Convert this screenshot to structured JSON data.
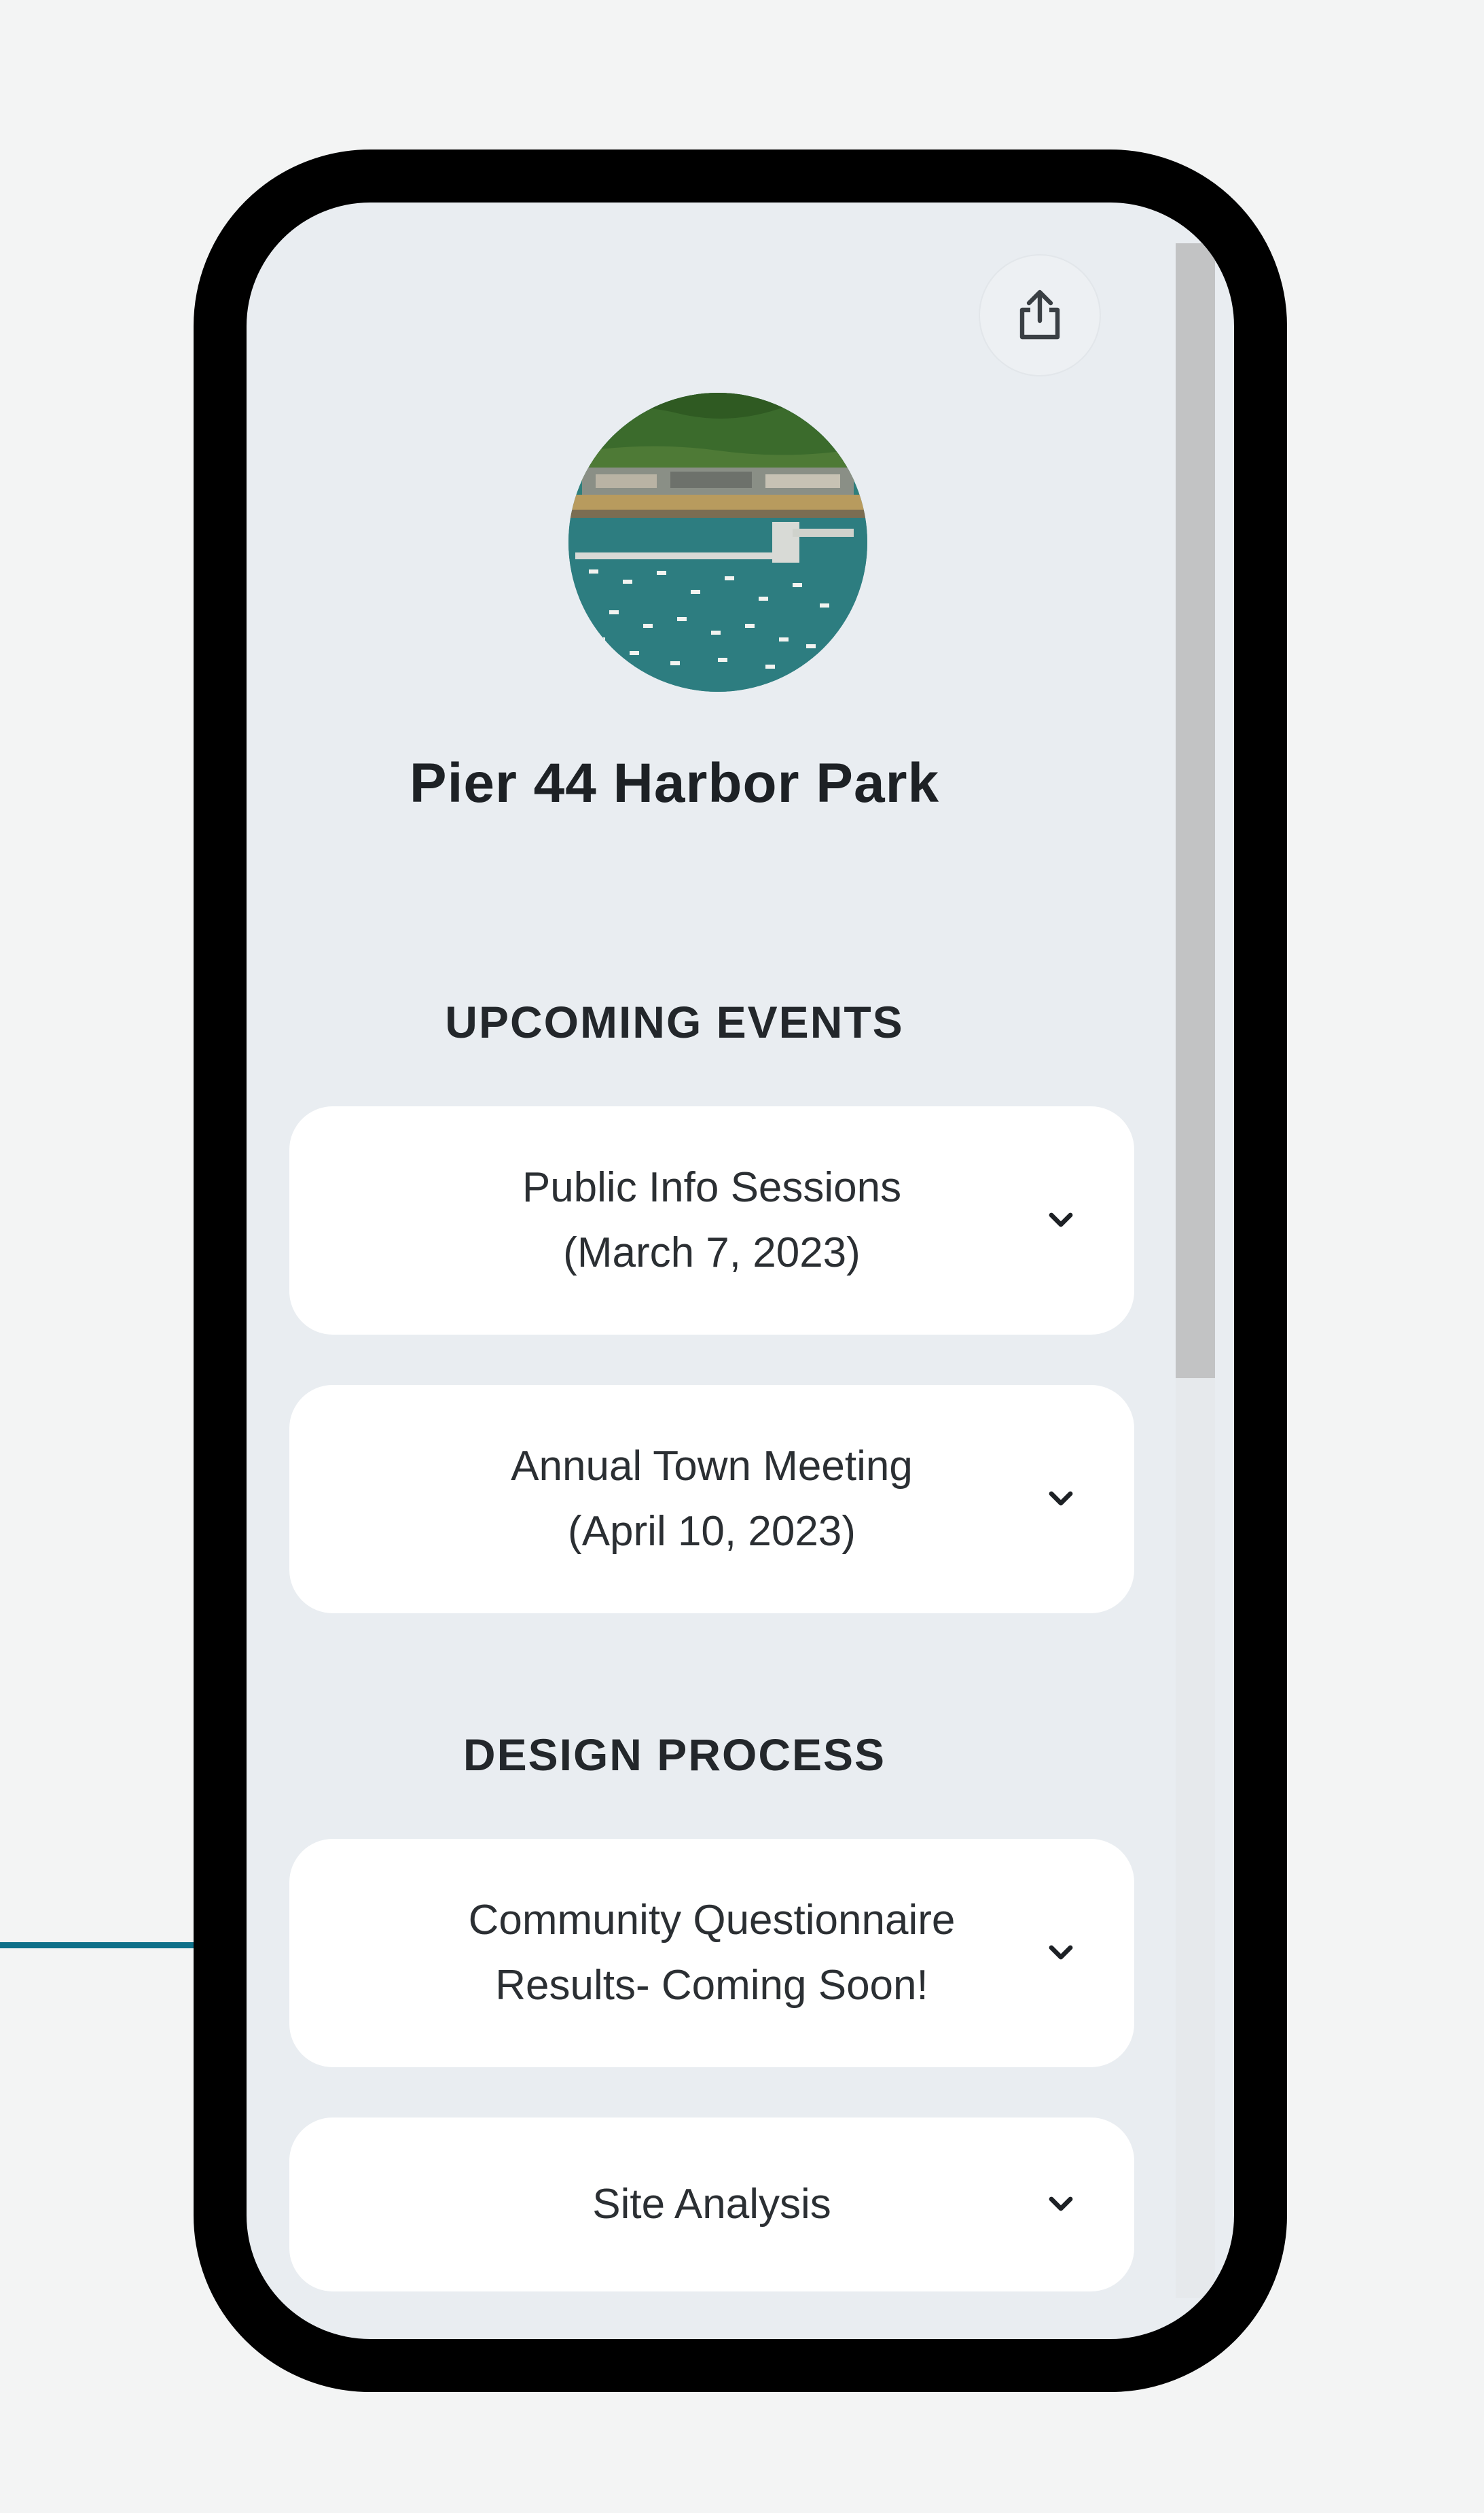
{
  "app": {
    "title": "Pier 44 Harbor Park"
  },
  "header": {
    "share_icon": "share-icon",
    "avatar_alt": "harbor-aerial-photo"
  },
  "sections": [
    {
      "heading": "UPCOMING EVENTS",
      "cards": [
        {
          "line1": "Public Info Sessions",
          "line2": "(March 7, 2023)",
          "icon": "chevron-down-icon"
        },
        {
          "line1": "Annual Town Meeting",
          "line2": "(April 10, 2023)",
          "icon": "chevron-down-icon"
        }
      ]
    },
    {
      "heading": "DESIGN PROCESS",
      "cards": [
        {
          "line1": "Community Questionnaire",
          "line2": "Results- Coming Soon!",
          "icon": "chevron-down-icon"
        },
        {
          "line1": "Site Analysis",
          "line2": "",
          "icon": "chevron-down-icon"
        }
      ]
    }
  ],
  "colors": {
    "page_background": "#f3f4f4",
    "phone_frame": "#000000",
    "screen_background": "#e9edf1",
    "card_background": "#ffffff",
    "pointer_line": "#0e7089"
  }
}
